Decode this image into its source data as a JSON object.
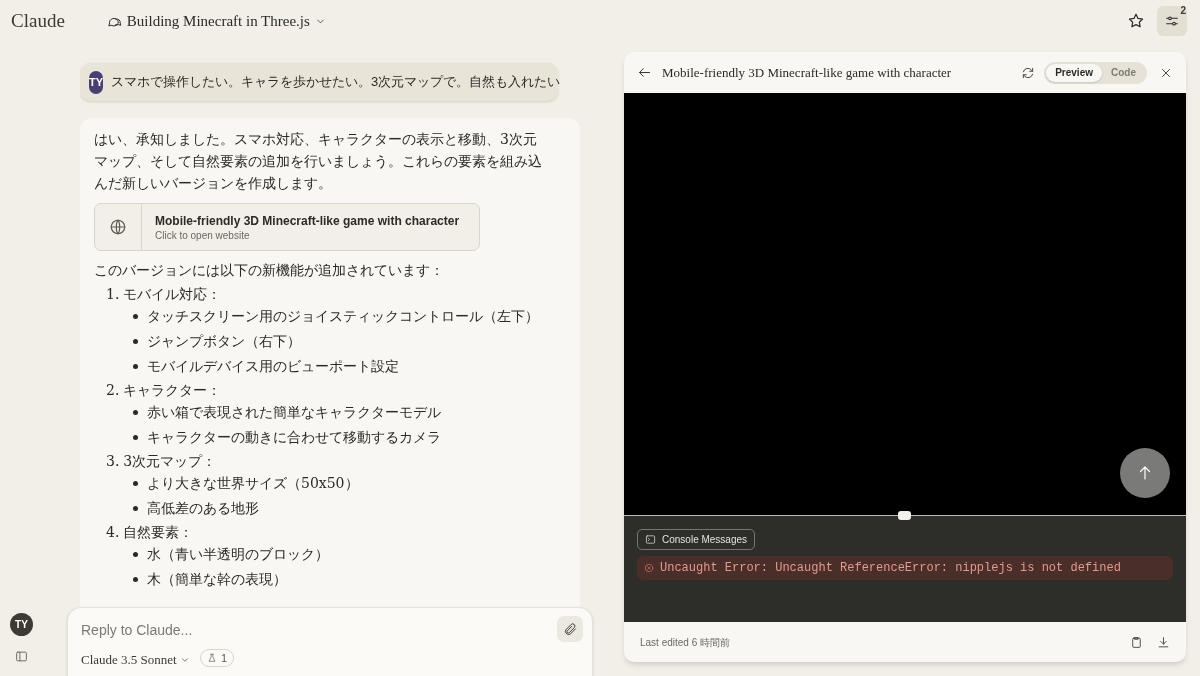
{
  "header": {
    "logo": "Claude",
    "conversation_title": "Building Minecraft in Three.js",
    "settings_badge": "2"
  },
  "chat": {
    "user_message": {
      "avatar": "TY",
      "text": "スマホで操作したい。キャラを歩かせたい。3次元マップで。自然も入れたい"
    },
    "response": {
      "intro": "はい、承知しました。スマホ対応、キャラクターの表示と移動、3次元マップ、そして自然要素の追加を行いましょう。これらの要素を組み込んだ新しいバージョンを作成します。",
      "artifact": {
        "title": "Mobile-friendly 3D Minecraft-like game with character",
        "subtitle": "Click to open website"
      },
      "lead": "このバージョンには以下の新機能が追加されています：",
      "sections": [
        {
          "number": "1.",
          "label": "モバイル対応：",
          "bullets": [
            "タッチスクリーン用のジョイスティックコントロール（左下）",
            "ジャンプボタン（右下）",
            "モバイルデバイス用のビューポート設定"
          ]
        },
        {
          "number": "2.",
          "label": "キャラクター：",
          "bullets": [
            "赤い箱で表現された簡単なキャラクターモデル",
            "キャラクターの動きに合わせて移動するカメラ"
          ]
        },
        {
          "number": "3.",
          "label": "3次元マップ：",
          "bullets": [
            "より大きな世界サイズ（50x50）",
            "高低差のある地形"
          ]
        },
        {
          "number": "4.",
          "label": "自然要素：",
          "bullets": [
            "水（青い半透明のブロック）",
            "木（簡単な幹の表現）"
          ]
        }
      ]
    }
  },
  "composer": {
    "placeholder": "Reply to Claude...",
    "model": "Claude 3.5 Sonnet",
    "tool_count": "1"
  },
  "sidebar": {
    "avatar": "TY"
  },
  "panel": {
    "title": "Mobile-friendly 3D Minecraft-like game with character",
    "tabs": [
      {
        "label": "Preview",
        "selected": true
      },
      {
        "label": "Code",
        "selected": false
      }
    ],
    "console_button": "Console Messages",
    "errors": [
      "Uncaught Error: Uncaught ReferenceError: nipplejs is not defined"
    ],
    "footer": "Last edited 6 時間前"
  }
}
